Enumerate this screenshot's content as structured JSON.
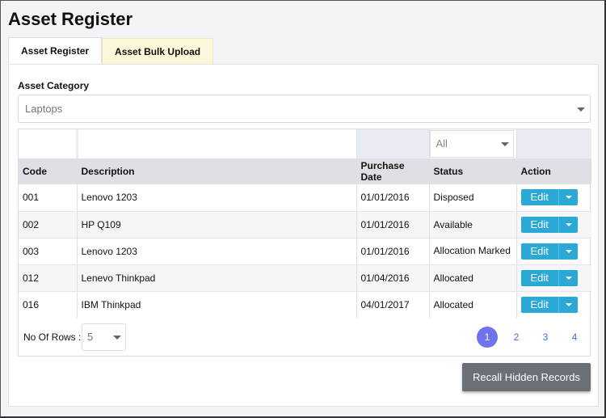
{
  "page": {
    "title": "Asset Register"
  },
  "tabs": [
    {
      "label": "Asset Register",
      "active": true
    },
    {
      "label": "Asset Bulk Upload",
      "active": false
    }
  ],
  "category": {
    "label": "Asset Category",
    "value": "Laptops"
  },
  "filters": {
    "status_value": "All"
  },
  "table": {
    "columns": [
      "Code",
      "Description",
      "Purchase Date",
      "Status",
      "Action"
    ],
    "rows": [
      {
        "code": "001",
        "description": "Lenovo 1203",
        "purchase_date": "01/01/2016",
        "status": "Disposed",
        "action": "Edit"
      },
      {
        "code": "002",
        "description": "HP Q109",
        "purchase_date": "01/01/2016",
        "status": "Available",
        "action": "Edit"
      },
      {
        "code": "003",
        "description": "Lenovo 1203",
        "purchase_date": "01/01/2016",
        "status": "Allocation Marked",
        "action": "Edit"
      },
      {
        "code": "012",
        "description": "Lenevo Thinkpad",
        "purchase_date": "01/04/2016",
        "status": "Allocated",
        "action": "Edit"
      },
      {
        "code": "016",
        "description": "IBM Thinkpad",
        "purchase_date": "04/01/2017",
        "status": "Allocated",
        "action": "Edit"
      }
    ]
  },
  "pagination": {
    "rows_label": "No Of Rows :",
    "rows_value": "5",
    "pages": [
      "1",
      "2",
      "3",
      "4"
    ],
    "current_page": "1"
  },
  "actions": {
    "recall_label": "Recall Hidden Records"
  },
  "colors": {
    "accent": "#2aa8d6",
    "pager_active": "#6f73f0",
    "recall_button": "#6b7077",
    "tab_inactive": "#fbf8d9"
  },
  "icons": {
    "dropdown": "caret-down-icon"
  }
}
